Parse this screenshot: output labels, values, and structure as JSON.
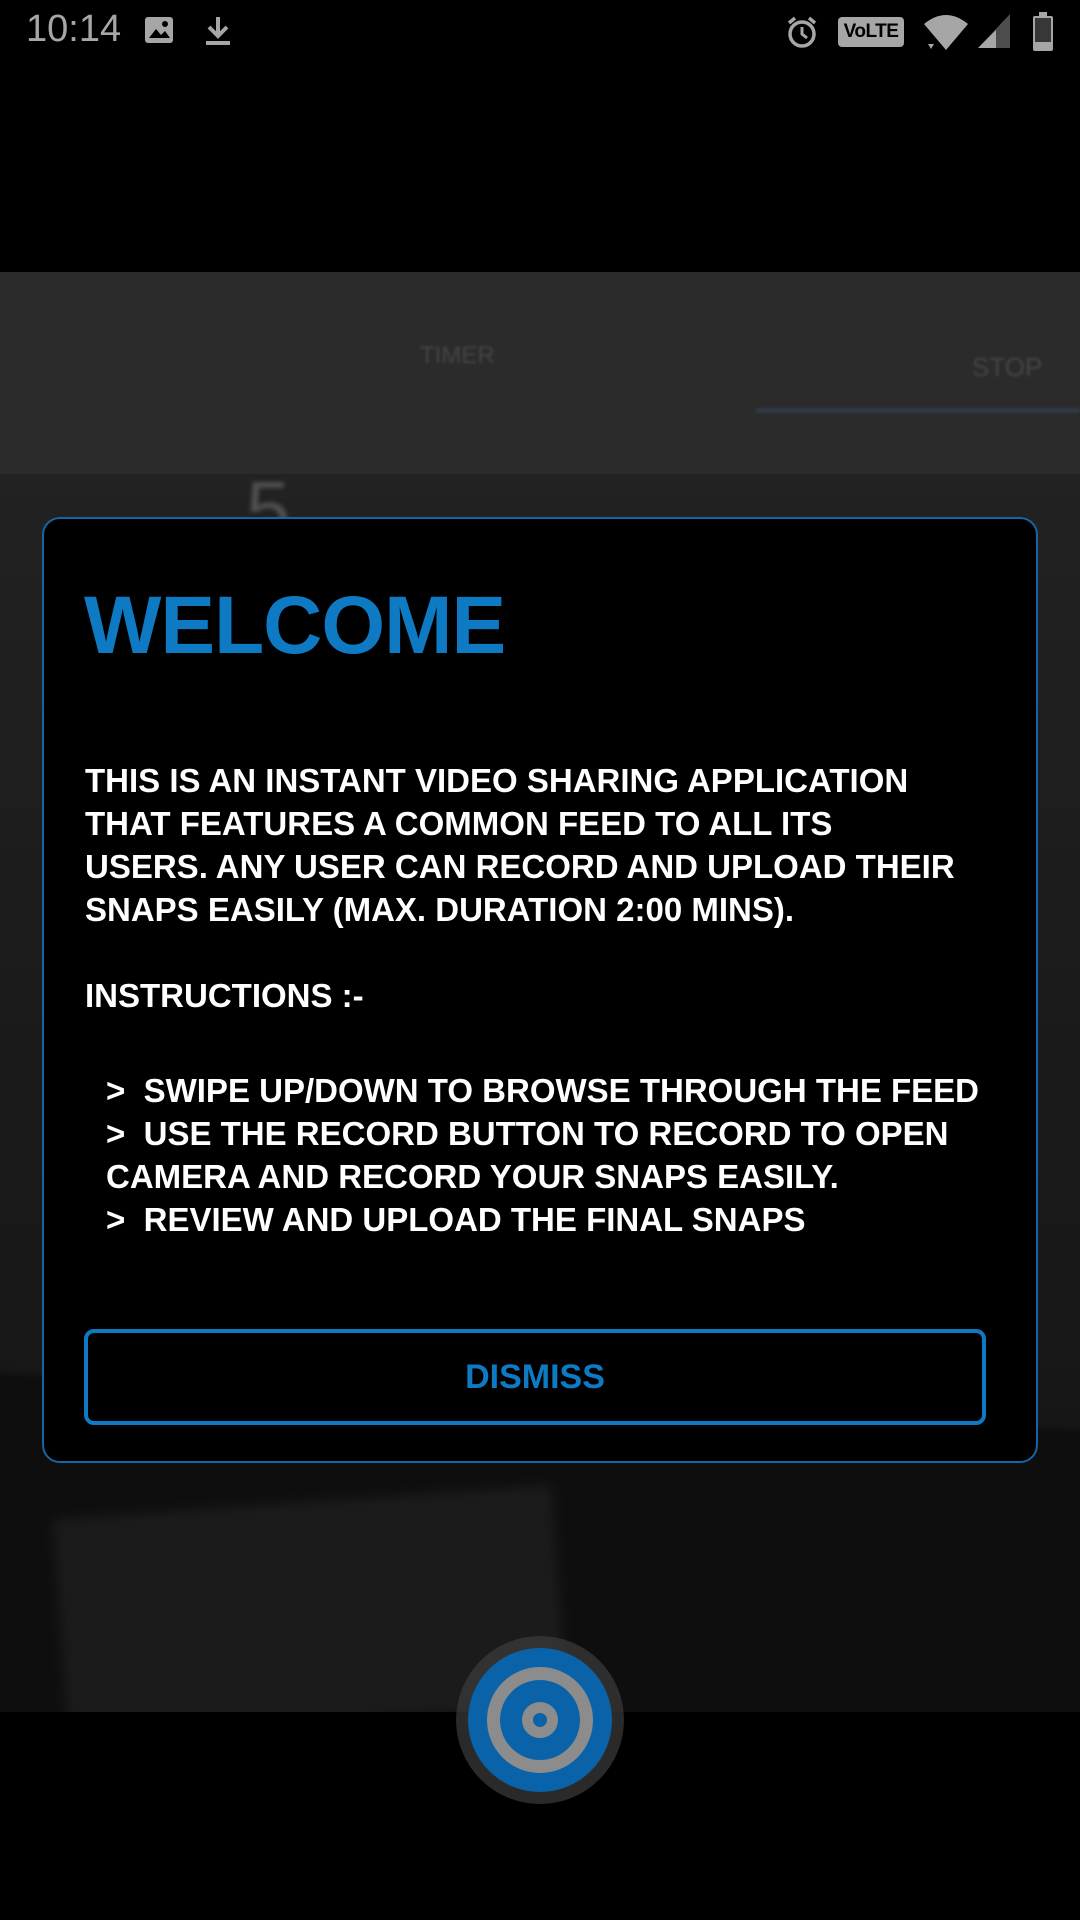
{
  "status_bar": {
    "time": "10:14",
    "volte": "VoLTE",
    "icons": [
      "image-icon",
      "download-icon",
      "alarm-icon",
      "volte-icon",
      "wifi-icon",
      "signal-icon",
      "battery-icon"
    ]
  },
  "camera_background": {
    "timer_tab": "TIMER",
    "stop_tab": "STOP",
    "digit": "5"
  },
  "dialog": {
    "title": "WELCOME",
    "body": "THIS IS AN INSTANT VIDEO SHARING APPLICATION\nTHAT FEATURES A COMMON FEED TO ALL ITS\nUSERS. ANY USER CAN RECORD AND UPLOAD THEIR\nSNAPS EASILY (MAX. DURATION 2:00 MINS).",
    "instructions_heading": "INSTRUCTIONS :-",
    "instructions": ">  SWIPE UP/DOWN TO BROWSE THROUGH THE FEED\n>  USE THE RECORD BUTTON TO RECORD TO OPEN\nCAMERA AND RECORD YOUR SNAPS EASILY.\n>  REVIEW AND UPLOAD THE FINAL SNAPS",
    "dismiss_label": "DISMISS"
  },
  "colors": {
    "accent": "#0e7ac4",
    "dialog_border": "#1565a6",
    "record_button": "#0a63a8"
  }
}
